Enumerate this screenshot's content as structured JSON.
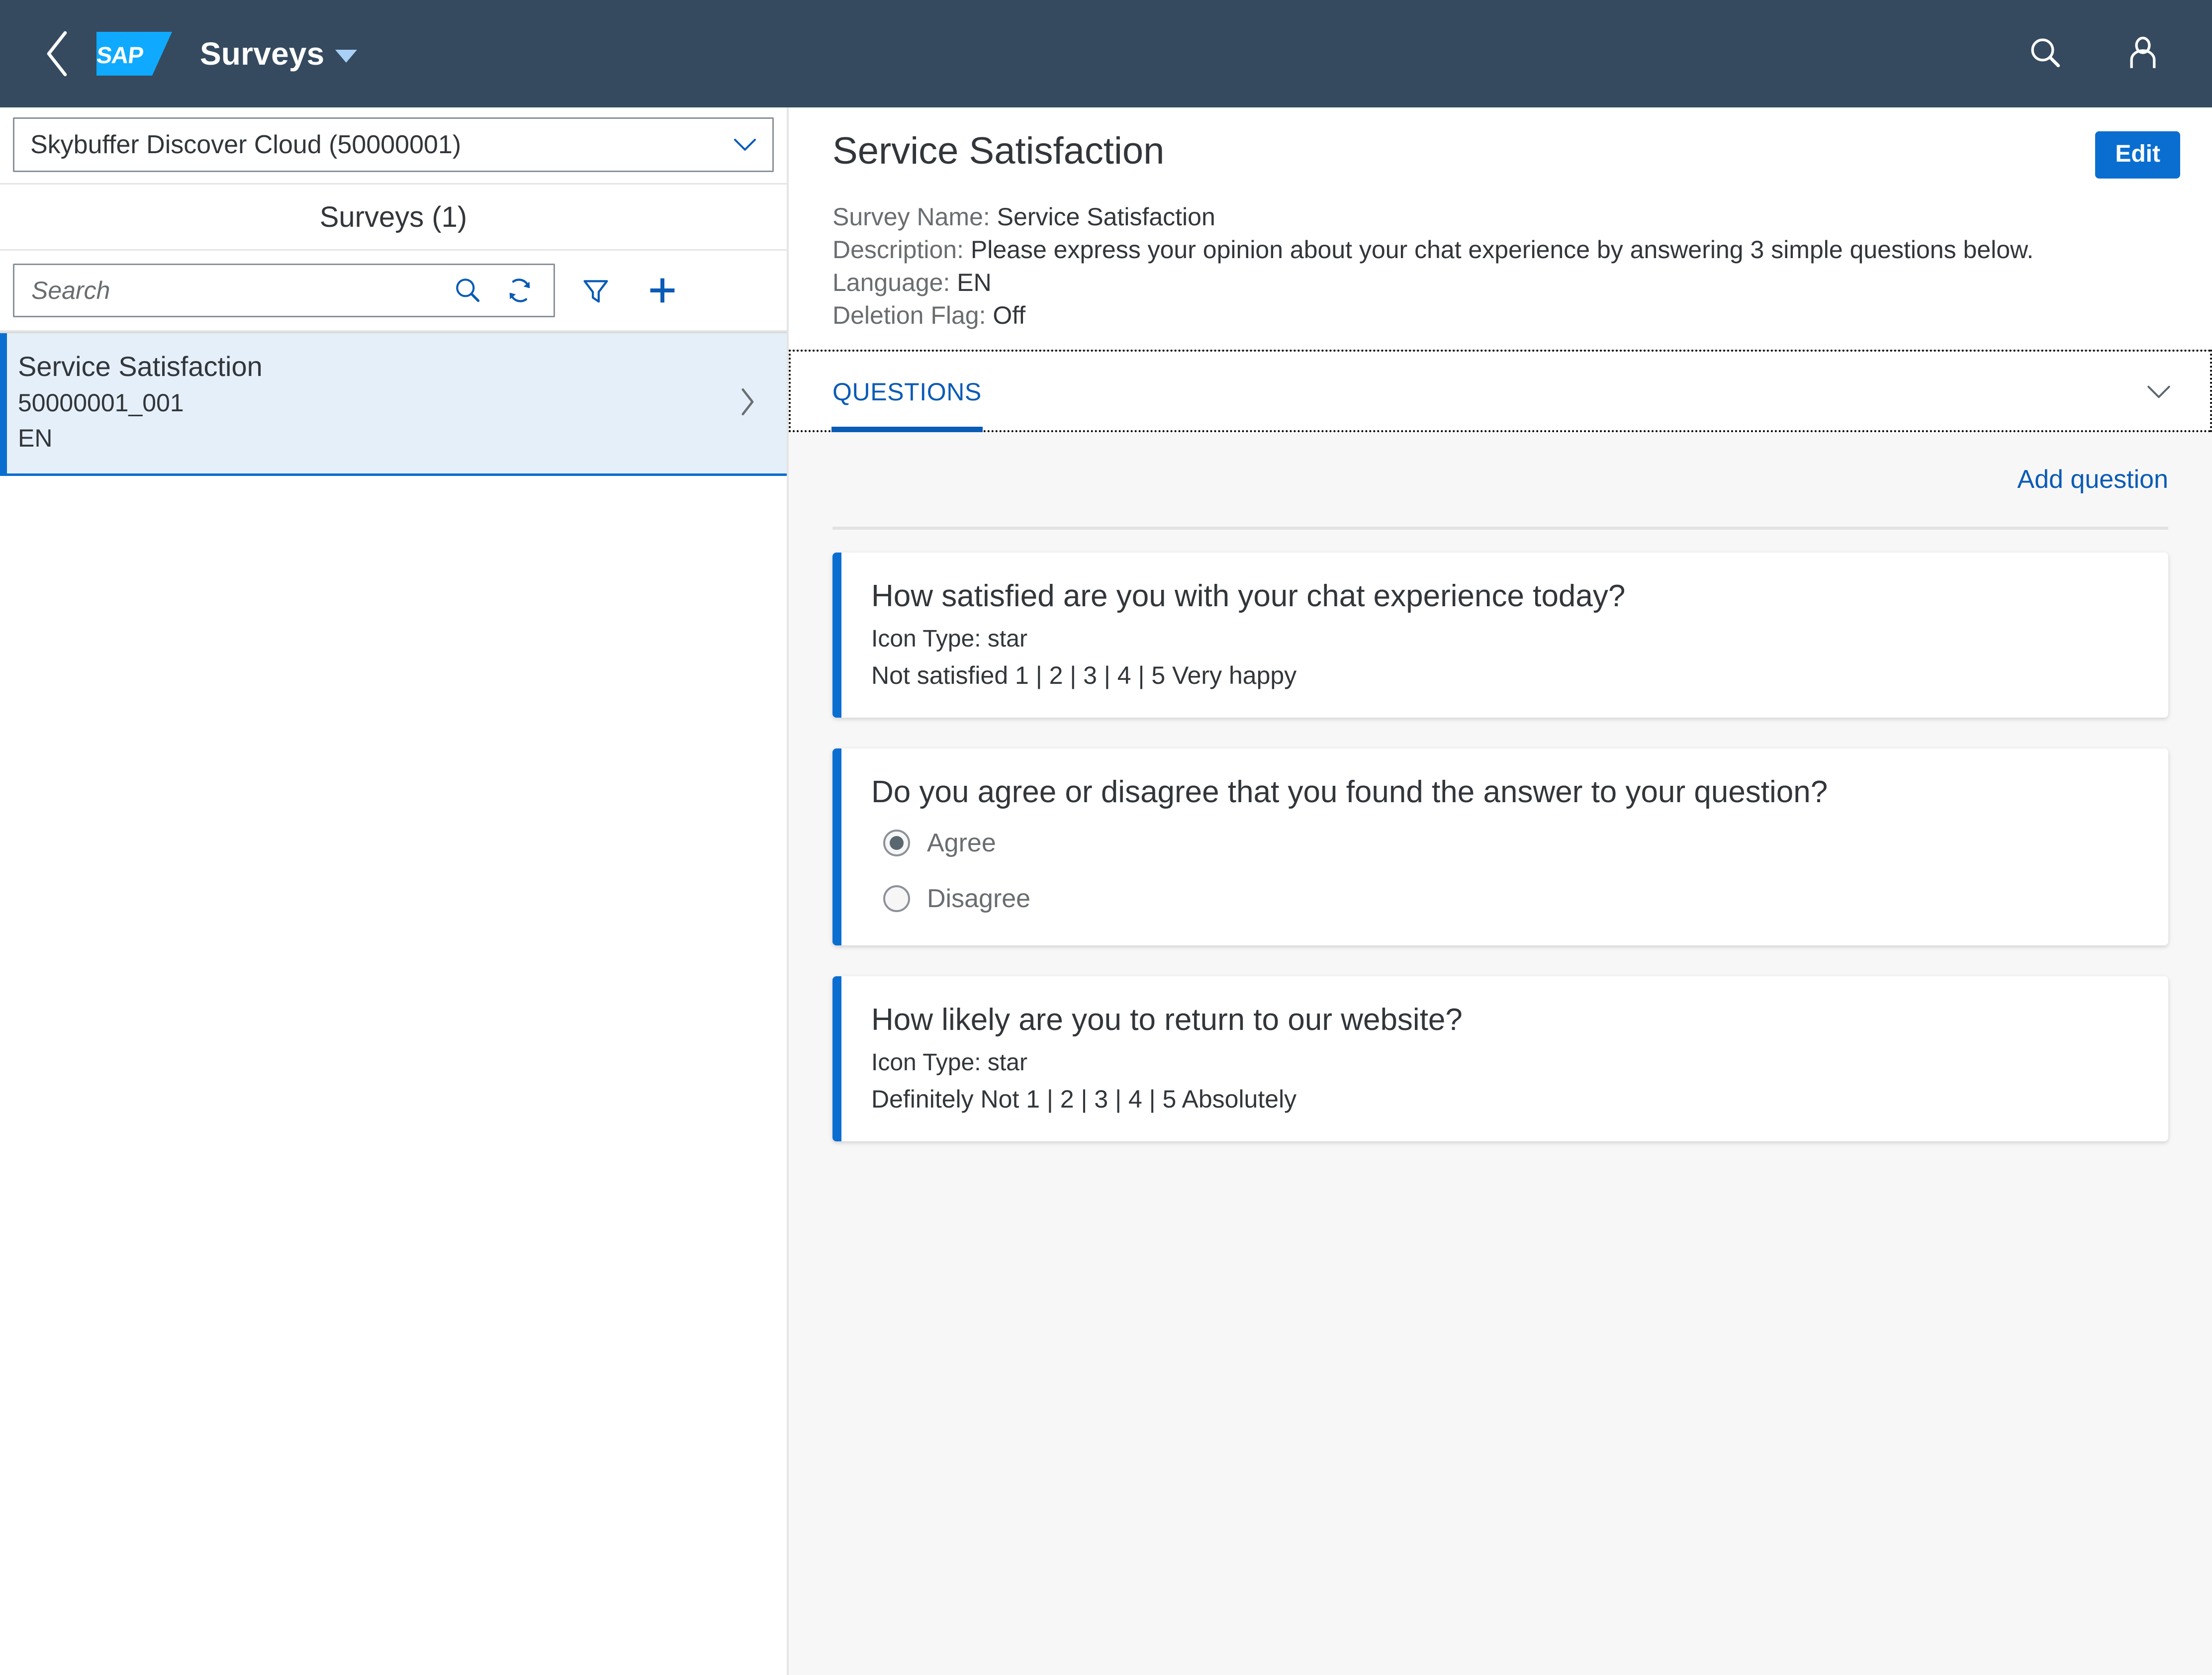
{
  "shell": {
    "back_icon": "chevron-left-icon",
    "logo_text": "SAP",
    "title": "Surveys",
    "search_icon": "search-icon",
    "user_icon": "user-avatar-icon"
  },
  "sidebar": {
    "tenant_select": {
      "value": "Skybuffer Discover Cloud (50000001)",
      "caret_icon": "chevron-down-icon"
    },
    "list_title": "Surveys (1)",
    "toolbar": {
      "search_placeholder": "Search",
      "search_value": "",
      "search_icon": "search-icon",
      "refresh_icon": "refresh-icon",
      "filter_icon": "filter-icon",
      "add_icon": "plus-icon"
    },
    "items": [
      {
        "title": "Service Satisfaction",
        "id": "50000001_001",
        "language": "EN",
        "chevron_icon": "chevron-right-icon",
        "selected": true
      }
    ]
  },
  "detail": {
    "title": "Service Satisfaction",
    "edit_label": "Edit",
    "facts": [
      {
        "label": "Survey Name:",
        "value": " Service Satisfaction"
      },
      {
        "label": "Description:",
        "value": " Please express your opinion about your chat experience by answering 3 simple questions below."
      },
      {
        "label": "Language:",
        "value": " EN"
      },
      {
        "label": "Deletion Flag:",
        "value": " Off"
      }
    ],
    "tabs": [
      {
        "label": "QUESTIONS",
        "selected": true
      }
    ],
    "collapse_icon": "chevron-down-icon",
    "add_question_label": "Add question",
    "questions": [
      {
        "title": "How satisfied are you with your chat experience today?",
        "icon_type": "Icon Type: star",
        "scale": "Not satisfied 1 | 2 | 3 | 4 | 5 Very happy",
        "options": []
      },
      {
        "title": "Do you agree or disagree that you found the answer to your question?",
        "icon_type": "",
        "scale": "",
        "options": [
          {
            "label": "Agree",
            "selected": true
          },
          {
            "label": "Disagree",
            "selected": false
          }
        ]
      },
      {
        "title": "How likely are you to return to our website?",
        "icon_type": "Icon Type: star",
        "scale": "Definitely Not 1 | 2 | 3 | 4 | 5 Absolutely",
        "options": []
      }
    ]
  },
  "colors": {
    "shell_bg": "#354a5f",
    "accent": "#0a6ed1",
    "link": "#0a5bb5",
    "selected_row": "#e5eff9",
    "page_bg": "#f7f7f7",
    "logo_blue": "#0faaff"
  }
}
